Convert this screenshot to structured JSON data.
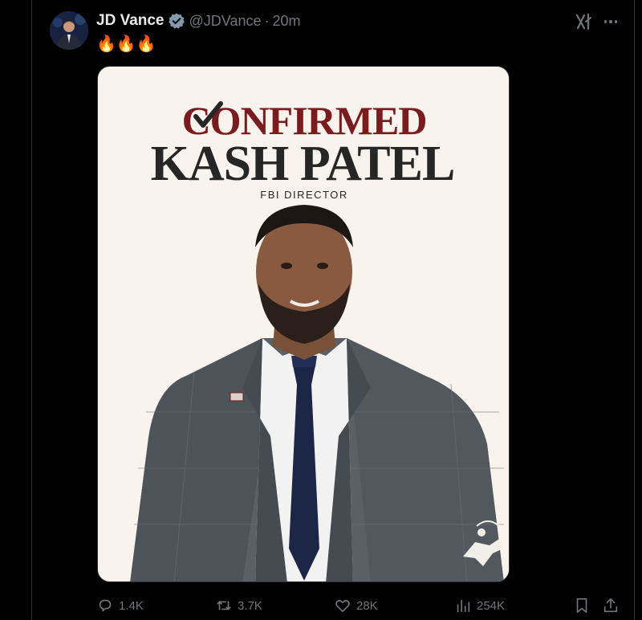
{
  "tweet": {
    "author_name": "JD Vance",
    "handle": "@JDVance",
    "separator": "·",
    "time": "20m",
    "text": "🔥🔥🔥",
    "verified": true
  },
  "media": {
    "headline": "CONFIRMED",
    "name": "KASH PATEL",
    "title": "FBI DIRECTOR",
    "accent_color": "#7a1b1e",
    "dark_color": "#262626",
    "background_color": "#f8f3ec"
  },
  "actions": {
    "replies": "1.4K",
    "reposts": "3.7K",
    "likes": "28K",
    "views": "254K"
  },
  "icons": {
    "grok": "grok-icon",
    "more": "more-icon",
    "reply": "reply-icon",
    "repost": "repost-icon",
    "like": "heart-icon",
    "views": "views-icon",
    "bookmark": "bookmark-icon",
    "share": "share-icon",
    "verified": "verified-badge-icon"
  }
}
